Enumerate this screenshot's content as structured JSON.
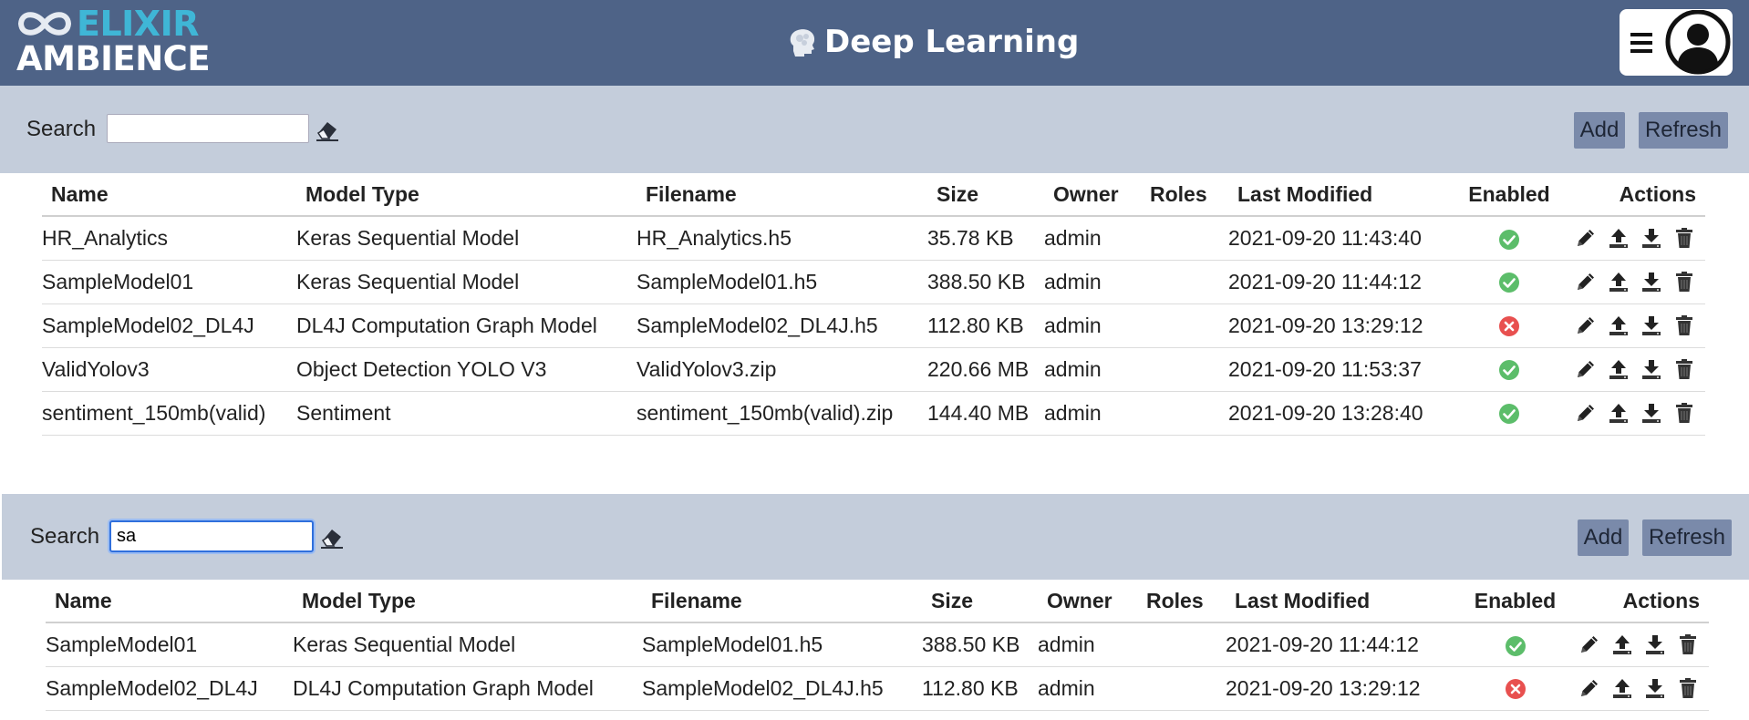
{
  "header": {
    "logo_line1": "ELIXIR",
    "logo_line2": "AMBIENCE",
    "title": "Deep Learning",
    "icons": [
      "elixir-infinity-icon",
      "brain-head-icon",
      "hamburger-menu-icon",
      "user-avatar-icon"
    ]
  },
  "colors": {
    "header_bg": "#4e6387",
    "panel_bg": "#c4cddb",
    "button_bg": "#7a8aaa",
    "logo_accent": "#3fb6d6",
    "enabled_green": "#5cbd6a",
    "disabled_red": "#e8504f"
  },
  "panel1": {
    "search_label": "Search",
    "search_value": "",
    "add_label": "Add",
    "refresh_label": "Refresh"
  },
  "panel2": {
    "search_label": "Search",
    "search_value": "sa",
    "add_label": "Add",
    "refresh_label": "Refresh"
  },
  "columns": [
    "Name",
    "Model Type",
    "Filename",
    "Size",
    "Owner",
    "Roles",
    "Last Modified",
    "Enabled",
    "Actions"
  ],
  "table1": {
    "rows": [
      {
        "name": "HR_Analytics",
        "type": "Keras Sequential Model",
        "file": "HR_Analytics.h5",
        "size": "35.78 KB",
        "owner": "admin",
        "roles": "",
        "modified": "2021-09-20 11:43:40",
        "enabled": true
      },
      {
        "name": "SampleModel01",
        "type": "Keras Sequential Model",
        "file": "SampleModel01.h5",
        "size": "388.50 KB",
        "owner": "admin",
        "roles": "",
        "modified": "2021-09-20 11:44:12",
        "enabled": true
      },
      {
        "name": "SampleModel02_DL4J",
        "type": "DL4J Computation Graph Model",
        "file": "SampleModel02_DL4J.h5",
        "size": "112.80 KB",
        "owner": "admin",
        "roles": "",
        "modified": "2021-09-20 13:29:12",
        "enabled": false
      },
      {
        "name": "ValidYolov3",
        "type": "Object Detection YOLO V3",
        "file": "ValidYolov3.zip",
        "size": "220.66 MB",
        "owner": "admin",
        "roles": "",
        "modified": "2021-09-20 11:53:37",
        "enabled": true
      },
      {
        "name": "sentiment_150mb(valid)",
        "type": "Sentiment",
        "file": "sentiment_150mb(valid).zip",
        "size": "144.40 MB",
        "owner": "admin",
        "roles": "",
        "modified": "2021-09-20 13:28:40",
        "enabled": true
      }
    ]
  },
  "table2": {
    "rows": [
      {
        "name": "SampleModel01",
        "type": "Keras Sequential Model",
        "file": "SampleModel01.h5",
        "size": "388.50 KB",
        "owner": "admin",
        "roles": "",
        "modified": "2021-09-20 11:44:12",
        "enabled": true
      },
      {
        "name": "SampleModel02_DL4J",
        "type": "DL4J Computation Graph Model",
        "file": "SampleModel02_DL4J.h5",
        "size": "112.80 KB",
        "owner": "admin",
        "roles": "",
        "modified": "2021-09-20 13:29:12",
        "enabled": false
      }
    ]
  },
  "row_action_icons": [
    "edit-pencil-icon",
    "upload-icon",
    "download-icon",
    "delete-trash-icon"
  ]
}
